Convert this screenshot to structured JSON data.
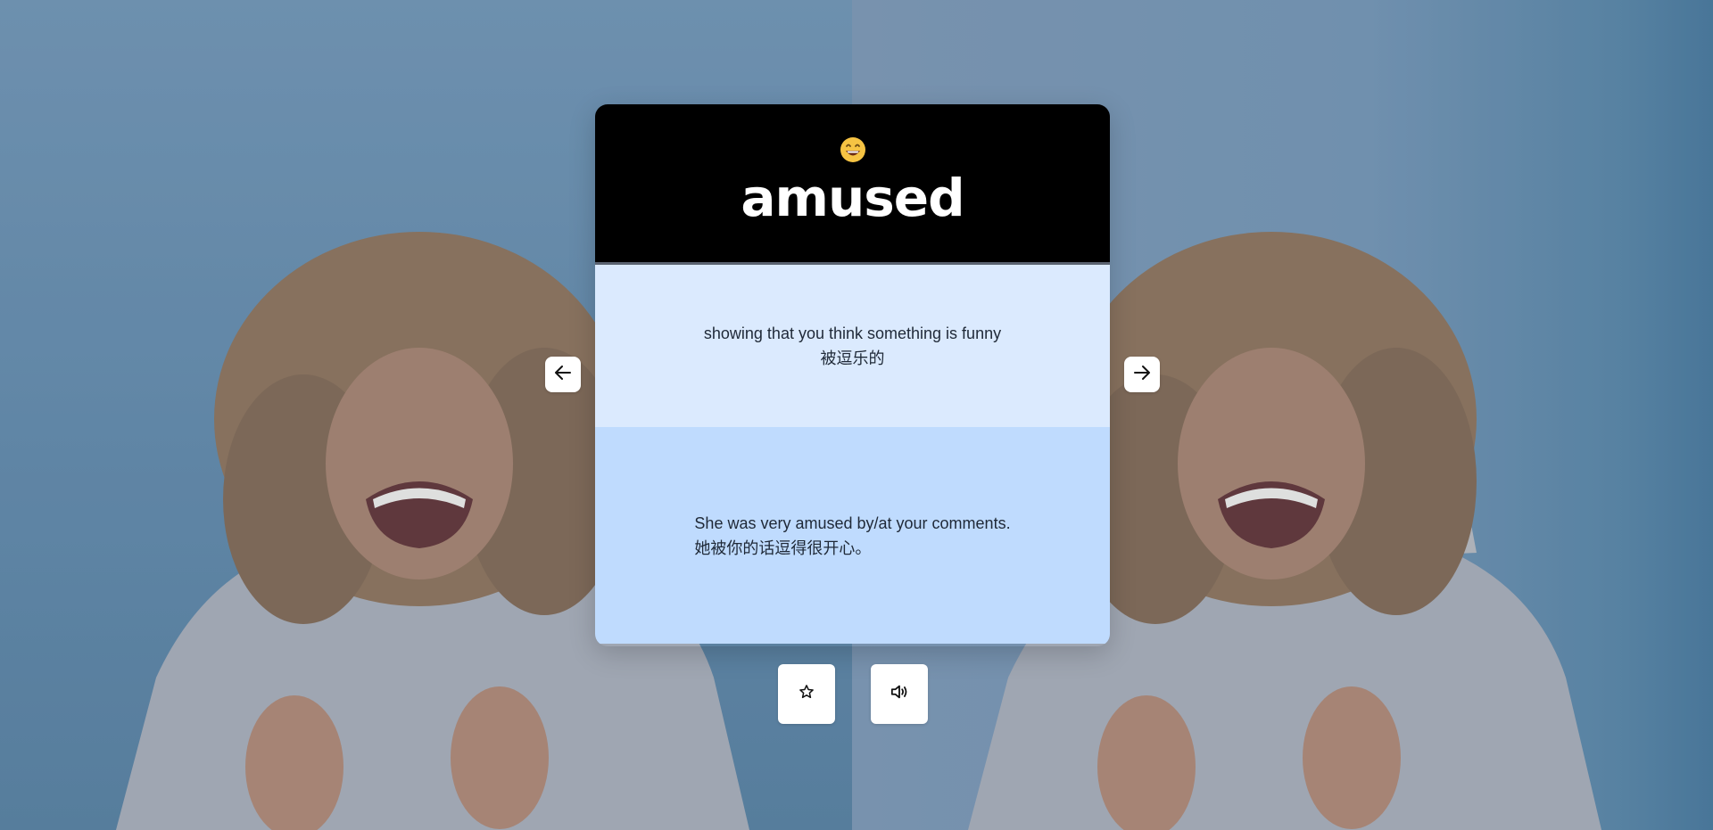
{
  "card": {
    "emoji_icon": "grinning-face-with-smiling-eyes-icon",
    "word": "amused",
    "definition_en": "showing that you think something is funny",
    "definition_zh": "被逗乐的",
    "example_en": "She was very amused by/at your comments.",
    "example_zh": "她被你的话逗得很开心。"
  },
  "navigation": {
    "prev_icon": "arrow-left-icon",
    "next_icon": "arrow-right-icon"
  },
  "actions": {
    "favorite_icon": "star-icon",
    "pronounce_icon": "speaker-icon"
  },
  "colors": {
    "header_bg": "#000000",
    "definition_bg": "#dbeafe",
    "example_bg": "#bfdbfe",
    "word_color": "#ffffff"
  }
}
